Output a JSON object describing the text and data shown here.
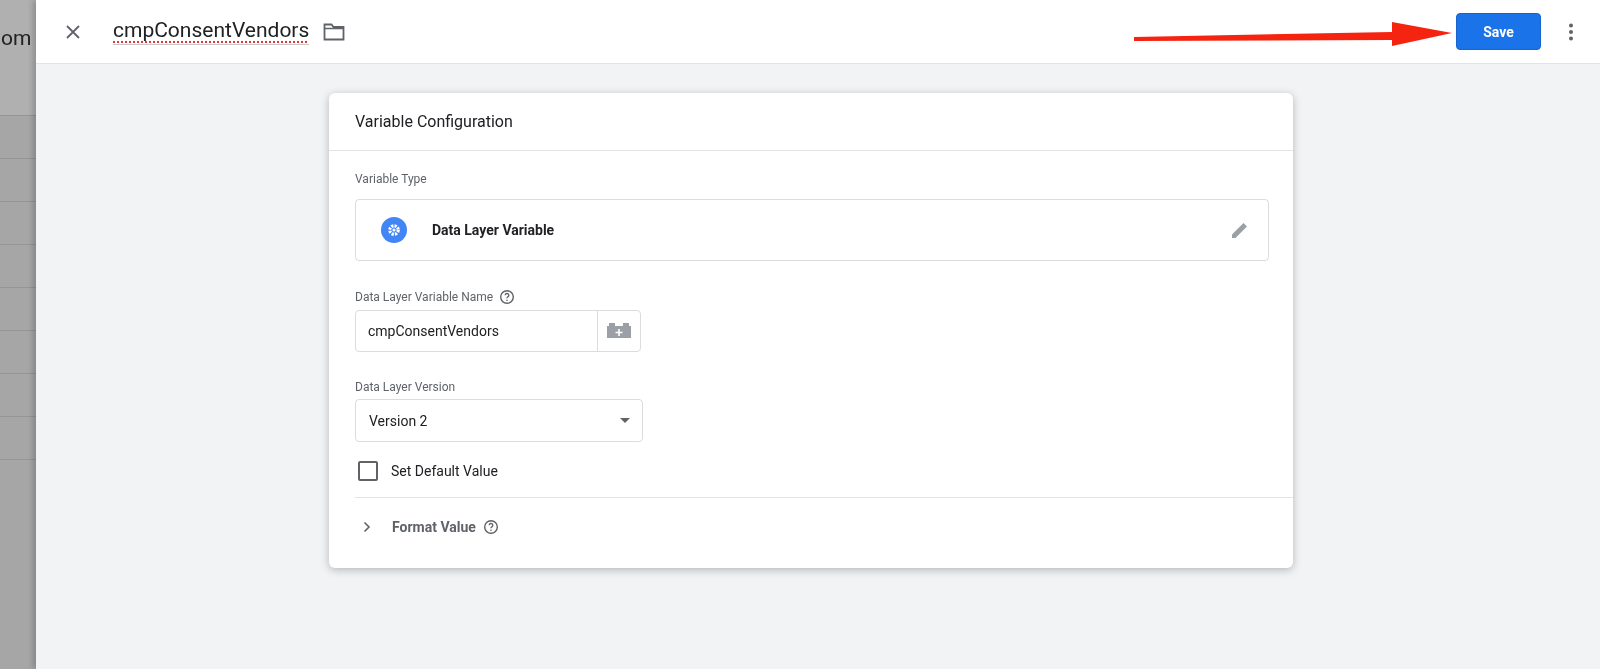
{
  "background": {
    "text": "om"
  },
  "header": {
    "title": "cmpConsentVendors",
    "save_label": "Save"
  },
  "card": {
    "title": "Variable Configuration",
    "variable_type": {
      "label": "Variable Type",
      "value": "Data Layer Variable"
    },
    "fields": [
      {
        "kind": "text",
        "label": "Data Layer Variable Name",
        "help": true,
        "value": "cmpConsentVendors"
      },
      {
        "kind": "select",
        "label": "Data Layer Version",
        "help": false,
        "value": "Version 2"
      }
    ],
    "checkbox": {
      "label": "Set Default Value",
      "checked": false
    },
    "section": {
      "label": "Format Value",
      "help": true,
      "expanded": false
    }
  }
}
